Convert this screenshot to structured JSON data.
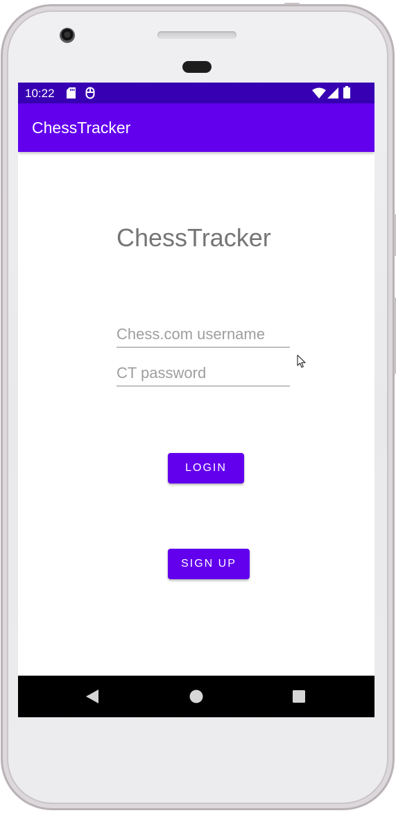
{
  "status_bar": {
    "time": "10:22",
    "left_icons": [
      "sd-card-icon",
      "usb-icon"
    ],
    "right_icons": [
      "wifi-icon",
      "signal-icon",
      "battery-icon"
    ]
  },
  "app_bar": {
    "title": "ChessTracker"
  },
  "login": {
    "heading": "ChessTracker",
    "username": {
      "value": "",
      "placeholder": "Chess.com username"
    },
    "password": {
      "value": "",
      "placeholder": "CT password"
    },
    "login_label": "LOGIN",
    "signup_label": "SIGN UP"
  },
  "nav_bar": {
    "icons": [
      "back-icon",
      "home-icon",
      "recents-icon"
    ]
  },
  "colors": {
    "status_bar": "#3700b3",
    "primary": "#6200ee",
    "heading_text": "#757575",
    "hint_text": "#9e9e9e",
    "nav_bar": "#000000"
  }
}
